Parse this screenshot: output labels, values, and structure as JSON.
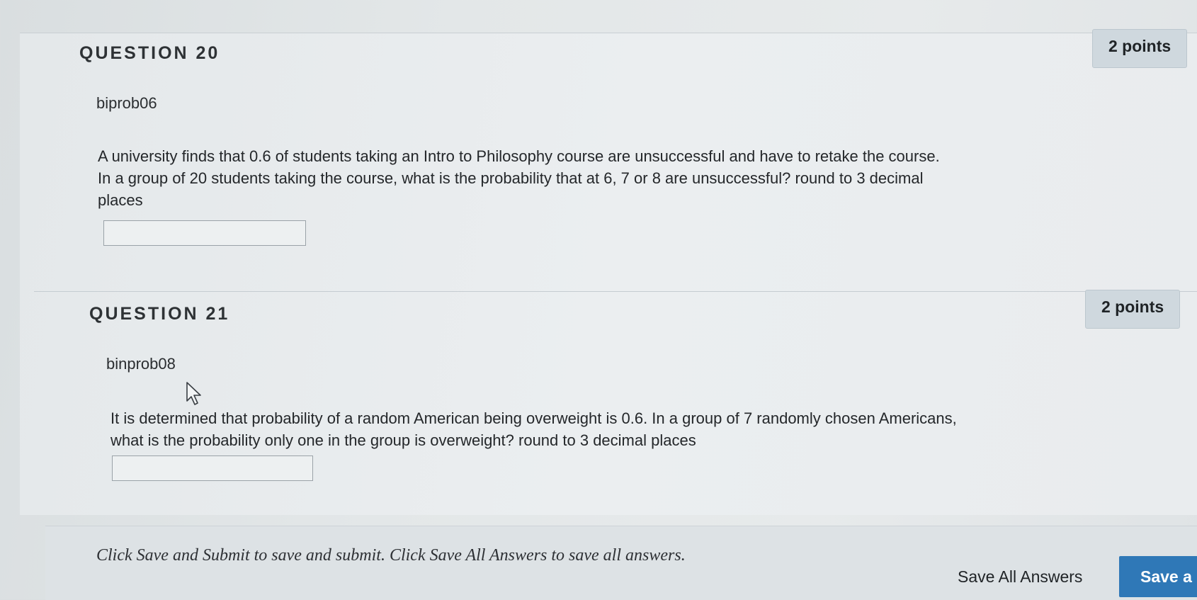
{
  "questions": [
    {
      "title": "QUESTION 20",
      "points": "2 points",
      "name": "biprob06",
      "text_lines": [
        "A university finds that 0.6 of students taking an Intro to Philosophy course  are unsuccessful and have to retake the course.",
        "In a group of 20 students taking the course, what is the probability that at 6, 7 or 8 are unsuccessful?  round to 3 decimal",
        "places"
      ],
      "answer_value": ""
    },
    {
      "title": "QUESTION 21",
      "points": "2 points",
      "name": "binprob08",
      "text_lines": [
        "It is determined that probability of a random American being overweight is 0.6. In a group of 7 randomly chosen Americans,",
        "what is the probability only one in the group is overweight?  round to 3 decimal places"
      ],
      "answer_value": ""
    }
  ],
  "footer": {
    "instructions": "Click Save and Submit to save and submit. Click Save All Answers to save all answers.",
    "save_all_label": "Save All Answers",
    "save_submit_label": "Save a"
  },
  "colors": {
    "primary_button": "#2f78b7",
    "points_badge": "#cfd8de"
  },
  "icons": {
    "mouse_cursor": "arrow-cursor-icon"
  }
}
